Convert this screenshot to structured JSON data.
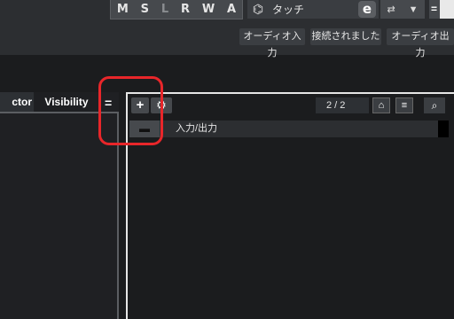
{
  "toolbar": {
    "msl_buttons": [
      "M",
      "S",
      "L",
      "R",
      "W",
      "A"
    ],
    "automation_mode": "タッチ",
    "e_label": "e",
    "input_label": "オーディオ入力",
    "connected_label": "接続されました",
    "output_label": "オーディオ出力"
  },
  "left_panel": {
    "tab_inspector": "ctor",
    "tab_visibility": "Visibility",
    "menu_icon": "menu-icon"
  },
  "right_panel": {
    "count": "2 / 2",
    "items": [
      {
        "icon": "folder-icon",
        "label": "入力/出力"
      }
    ]
  },
  "icons": {
    "add": "plus-icon",
    "settings": "gear-icon",
    "search": "search-icon"
  },
  "colors": {
    "highlight": "#e8262a",
    "background": "#1b1c1e"
  }
}
